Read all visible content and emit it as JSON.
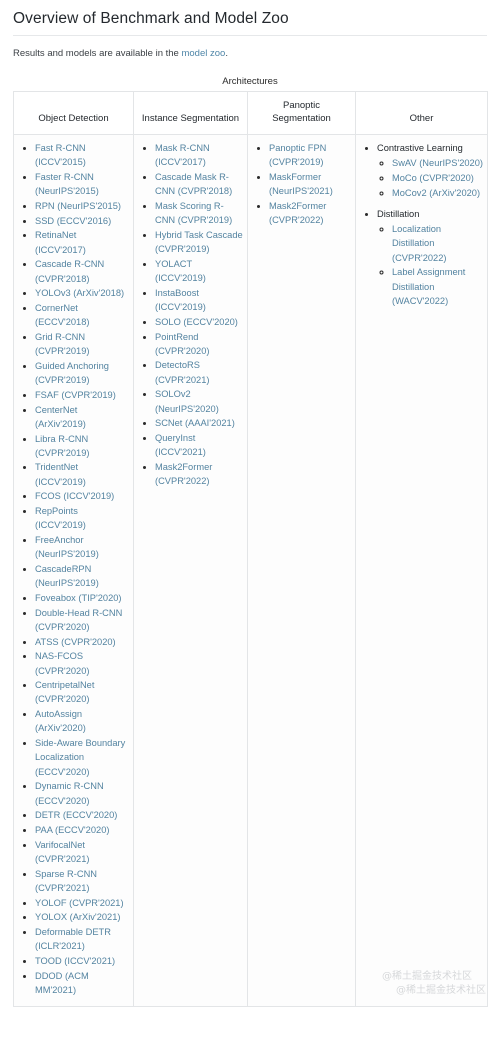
{
  "page": {
    "title": "Overview of Benchmark and Model Zoo",
    "intro_prefix": "Results and models are available in the ",
    "intro_link": "model zoo",
    "intro_suffix": ".",
    "table_caption": "Architectures",
    "watermark_line1": "@稀土掘金技术社区",
    "watermark_line2": "@稀土掘金技术社区"
  },
  "colors": {
    "link": "#5383a0",
    "intro_link": "#4f86a8",
    "text": "#2b2b2b",
    "border": "#e3e5e7",
    "cell_bg": "#fdfdfd",
    "header_bg": "#ffffff",
    "watermark": "#d6d8da"
  },
  "table": {
    "headers": [
      "Object Detection",
      "Instance Segmentation",
      "Panoptic Segmentation",
      "Other"
    ],
    "object_detection": [
      "Fast R-CNN (ICCV'2015)",
      "Faster R-CNN (NeurIPS'2015)",
      "RPN (NeurIPS'2015)",
      "SSD (ECCV'2016)",
      "RetinaNet (ICCV'2017)",
      "Cascade R-CNN (CVPR'2018)",
      "YOLOv3 (ArXiv'2018)",
      "CornerNet (ECCV'2018)",
      "Grid R-CNN (CVPR'2019)",
      "Guided Anchoring (CVPR'2019)",
      "FSAF (CVPR'2019)",
      "CenterNet (ArXiv'2019)",
      "Libra R-CNN (CVPR'2019)",
      "TridentNet (ICCV'2019)",
      "FCOS (ICCV'2019)",
      "RepPoints (ICCV'2019)",
      "FreeAnchor (NeurIPS'2019)",
      "CascadeRPN (NeurIPS'2019)",
      "Foveabox (TIP'2020)",
      "Double-Head R-CNN (CVPR'2020)",
      "ATSS (CVPR'2020)",
      "NAS-FCOS (CVPR'2020)",
      "CentripetalNet (CVPR'2020)",
      "AutoAssign (ArXiv'2020)",
      "Side-Aware Boundary Localization (ECCV'2020)",
      "Dynamic R-CNN (ECCV'2020)",
      "DETR (ECCV'2020)",
      "PAA (ECCV'2020)",
      "VarifocalNet (CVPR'2021)",
      "Sparse R-CNN (CVPR'2021)",
      "YOLOF (CVPR'2021)",
      "YOLOX (ArXiv'2021)",
      "Deformable DETR (ICLR'2021)",
      "TOOD (ICCV'2021)",
      "DDOD (ACM MM'2021)"
    ],
    "instance_segmentation": [
      "Mask R-CNN (ICCV'2017)",
      "Cascade Mask R-CNN (CVPR'2018)",
      "Mask Scoring R-CNN (CVPR'2019)",
      "Hybrid Task Cascade (CVPR'2019)",
      "YOLACT (ICCV'2019)",
      "InstaBoost (ICCV'2019)",
      "SOLO (ECCV'2020)",
      "PointRend (CVPR'2020)",
      "DetectoRS (CVPR'2021)",
      "SOLOv2 (NeurIPS'2020)",
      "SCNet (AAAI'2021)",
      "QueryInst (ICCV'2021)",
      "Mask2Former (CVPR'2022)"
    ],
    "panoptic_segmentation": [
      "Panoptic FPN (CVPR'2019)",
      "MaskFormer (NeurIPS'2021)",
      "Mask2Former (CVPR'2022)"
    ],
    "other": [
      {
        "label": "Contrastive Learning",
        "children": [
          "SwAV (NeurIPS'2020)",
          "MoCo (CVPR'2020)",
          "MoCov2 (ArXiv'2020)"
        ]
      },
      {
        "label": "Distillation",
        "children": [
          "Localization Distillation (CVPR'2022)",
          "Label Assignment Distillation (WACV'2022)"
        ]
      }
    ]
  }
}
